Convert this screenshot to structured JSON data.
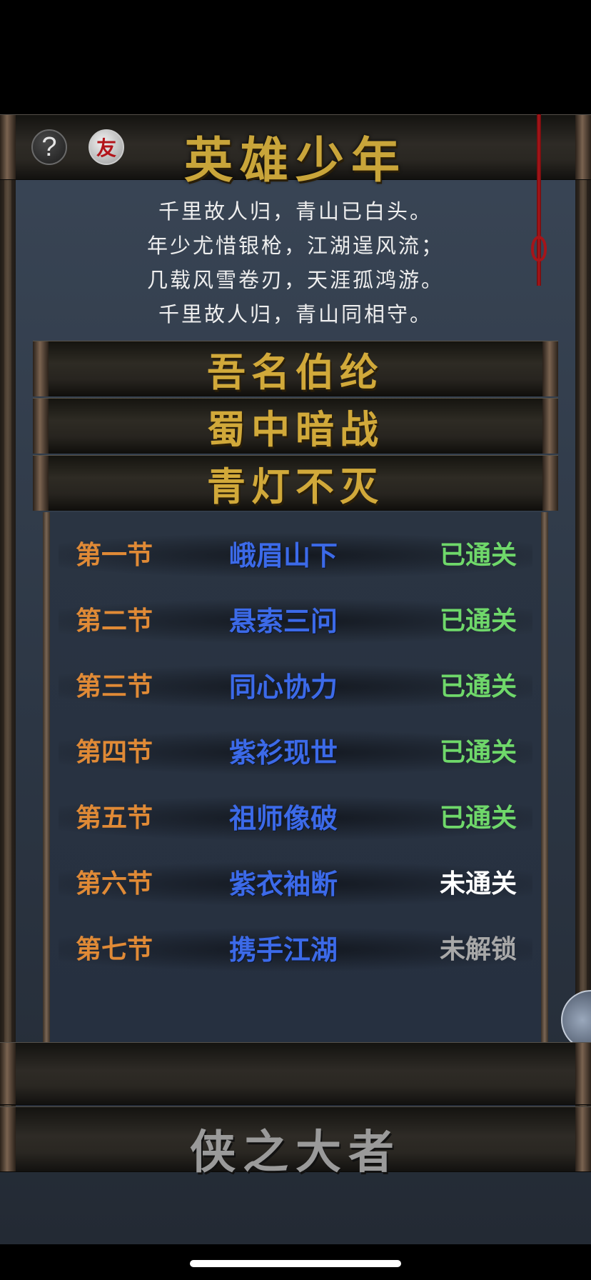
{
  "header": {
    "title": "英雄少年",
    "help_icon": "?",
    "friend_icon": "友"
  },
  "poem": [
    "千里故人归，青山已白头。",
    "年少尤惜银枪，江湖逞风流；",
    "几载风雪卷刃，天涯孤鸿游。",
    "千里故人归，青山同相守。"
  ],
  "chapters": [
    "吾名伯纶",
    "蜀中暗战",
    "青灯不灭"
  ],
  "sections": [
    {
      "num": "第一节",
      "name": "峨眉山下",
      "status": "已通关"
    },
    {
      "num": "第二节",
      "name": "悬索三问",
      "status": "已通关"
    },
    {
      "num": "第三节",
      "name": "同心协力",
      "status": "已通关"
    },
    {
      "num": "第四节",
      "name": "紫衫现世",
      "status": "已通关"
    },
    {
      "num": "第五节",
      "name": "祖师像破",
      "status": "已通关"
    },
    {
      "num": "第六节",
      "name": "紫衣袖断",
      "status": "未通关"
    },
    {
      "num": "第七节",
      "name": "携手江湖",
      "status": "未解锁"
    }
  ],
  "footer": {
    "title": "侠之大者"
  },
  "colors": {
    "title_gold": "#c9a53a",
    "section_number": "#e08a36",
    "section_name": "#3c6ae8",
    "status_cleared": "#6fd86a",
    "status_uncleared": "#ffffff",
    "status_locked": "#a8a8a8"
  }
}
